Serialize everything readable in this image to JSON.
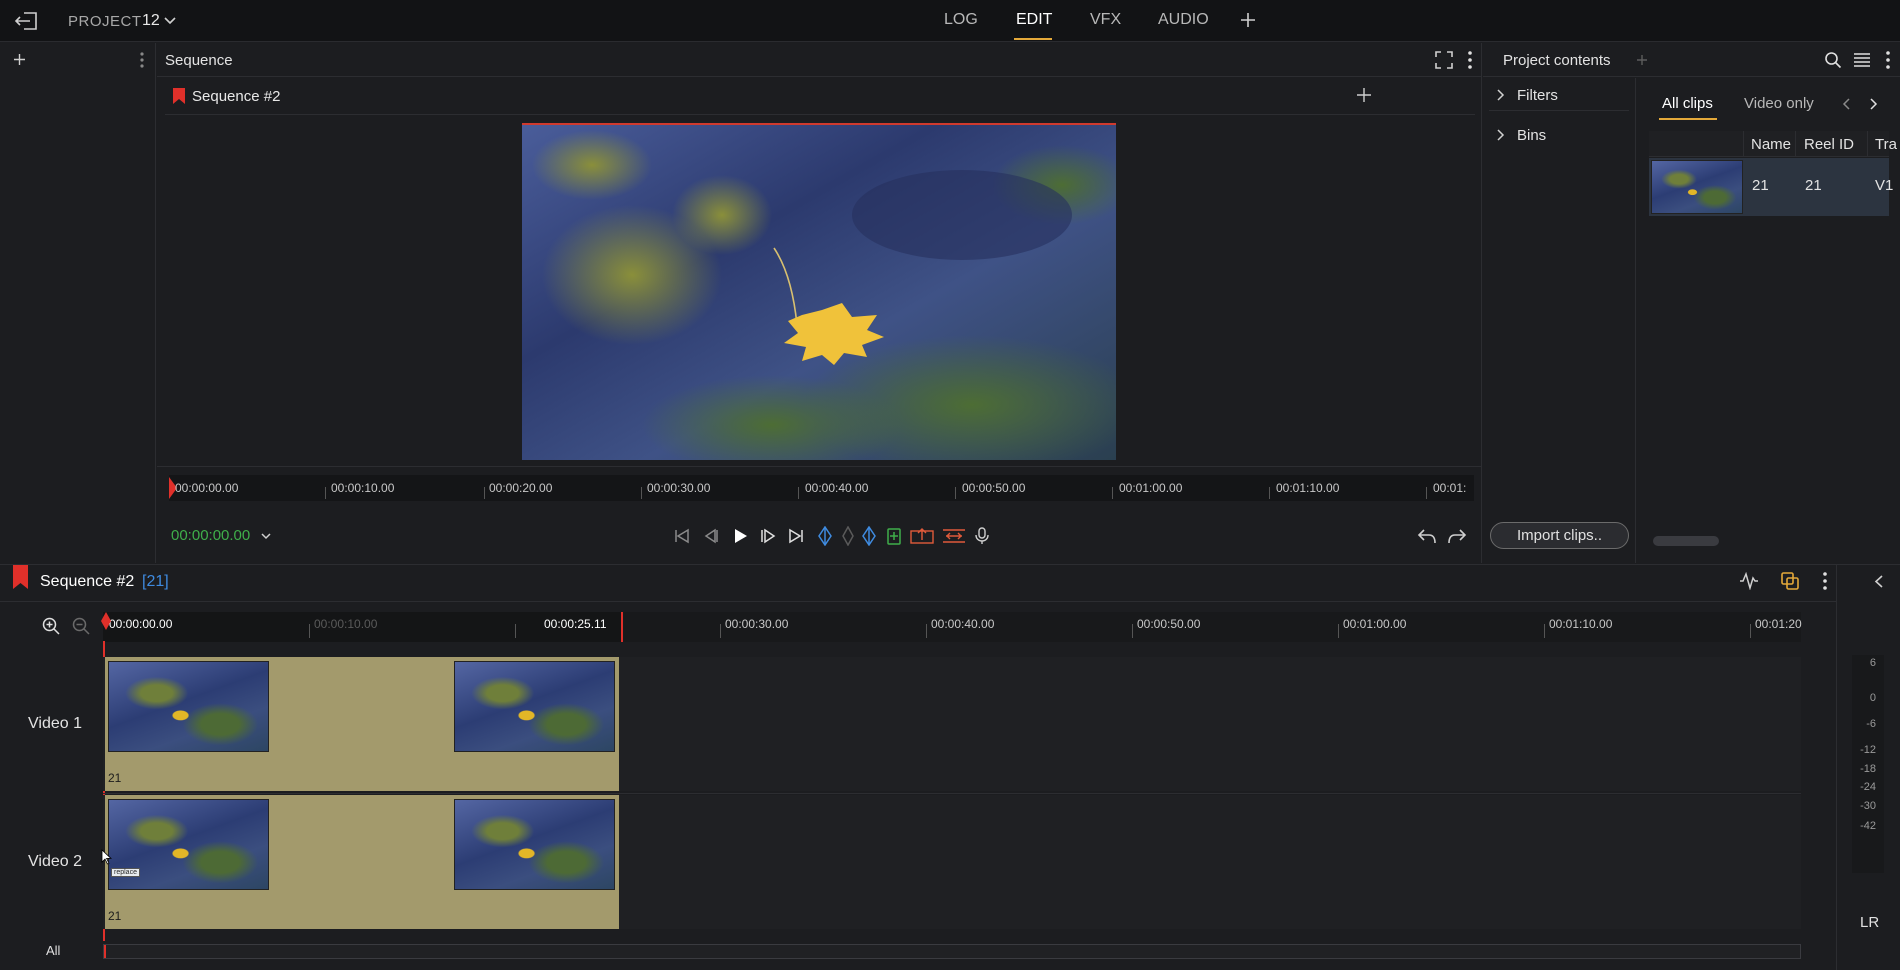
{
  "topbar": {
    "project_label": "PROJECT",
    "project_number": "12",
    "tabs": [
      "LOG",
      "EDIT",
      "VFX",
      "AUDIO"
    ],
    "active_tab": "EDIT"
  },
  "viewer": {
    "panel_title": "Sequence",
    "sequence_name": "Sequence #2",
    "ruler": [
      "00:00:00.00",
      "00:00:10.00",
      "00:00:20.00",
      "00:00:30.00",
      "00:00:40.00",
      "00:00:50.00",
      "00:01:00.00",
      "00:01:10.00",
      "00:01:"
    ],
    "timecode": "00:00:00.00"
  },
  "project": {
    "panel_title": "Project contents",
    "filters_label": "Filters",
    "bins_label": "Bins",
    "tabs": [
      "All clips",
      "Video only"
    ],
    "columns": [
      "Name",
      "Reel ID",
      "Tra"
    ],
    "row": {
      "name": "21",
      "reel_id": "21",
      "track": "V1"
    },
    "import_button": "Import clips.."
  },
  "timeline": {
    "sequence_name": "Sequence #2",
    "clip_count": "[21]",
    "ruler": [
      "00:00:00.00",
      "00:00:10.00",
      "00:00:25.11",
      "00:00:30.00",
      "00:00:40.00",
      "00:00:50.00",
      "00:01:00.00",
      "00:01:10.00",
      "00:01:20"
    ],
    "tracks": [
      {
        "label": "Video 1",
        "clip_label": "21"
      },
      {
        "label": "Video 2",
        "clip_label": "21"
      }
    ],
    "all_label": "All",
    "meter_labels": [
      "6",
      "0",
      "-6",
      "-12",
      "-18",
      "-24",
      "-30",
      "-42"
    ],
    "lr_label": "LR",
    "cursor_tooltip": "replace"
  },
  "colors": {
    "accent": "#e4a93a",
    "playhead": "#e0302a",
    "timecode_green": "#3fae4a",
    "clip_bg": "#a39a6c",
    "marker_blue": "#3f8be0"
  }
}
